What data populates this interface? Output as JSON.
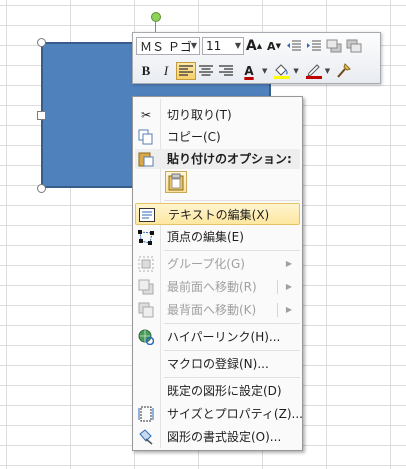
{
  "minitoolbar": {
    "font_name": "ＭＳ Ｐゴ",
    "font_size": "11",
    "grow_label": "A",
    "shrink_label": "A",
    "bold_label": "B",
    "italic_label": "I",
    "font_color_label": "A",
    "accent_color": "#c00000",
    "fill_color": "#ffff00",
    "line_color": "#c00000"
  },
  "menu": {
    "items": [
      {
        "label": "切り取り(T)",
        "icon": "scissors-icon",
        "enabled": true
      },
      {
        "label": "コピー(C)",
        "icon": "copy-icon",
        "enabled": true
      },
      {
        "label": "貼り付けのオプション:",
        "icon": "paste-icon",
        "enabled": true
      },
      {
        "label": "テキストの編集(X)",
        "icon": "edit-text-icon",
        "enabled": true,
        "highlighted": true
      },
      {
        "label": "頂点の編集(E)",
        "icon": "edit-points-icon",
        "enabled": true
      },
      {
        "label": "グループ化(G)",
        "icon": "group-icon",
        "enabled": false
      },
      {
        "label": "最前面へ移動(R)",
        "icon": "bring-front-icon",
        "enabled": false
      },
      {
        "label": "最背面へ移動(K)",
        "icon": "send-back-icon",
        "enabled": false
      },
      {
        "label": "ハイパーリンク(H)...",
        "icon": "hyperlink-icon",
        "enabled": true
      },
      {
        "label": "マクロの登録(N)...",
        "icon": "",
        "enabled": true
      },
      {
        "label": "既定の図形に設定(D)",
        "icon": "",
        "enabled": true
      },
      {
        "label": "サイズとプロパティ(Z)...",
        "icon": "size-properties-icon",
        "enabled": true
      },
      {
        "label": "図形の書式設定(O)...",
        "icon": "format-shape-icon",
        "enabled": true
      }
    ]
  },
  "colors": {
    "shape_fill": "#4f81bd",
    "shape_border": "#385d8a",
    "highlight": "#fde7a0"
  }
}
